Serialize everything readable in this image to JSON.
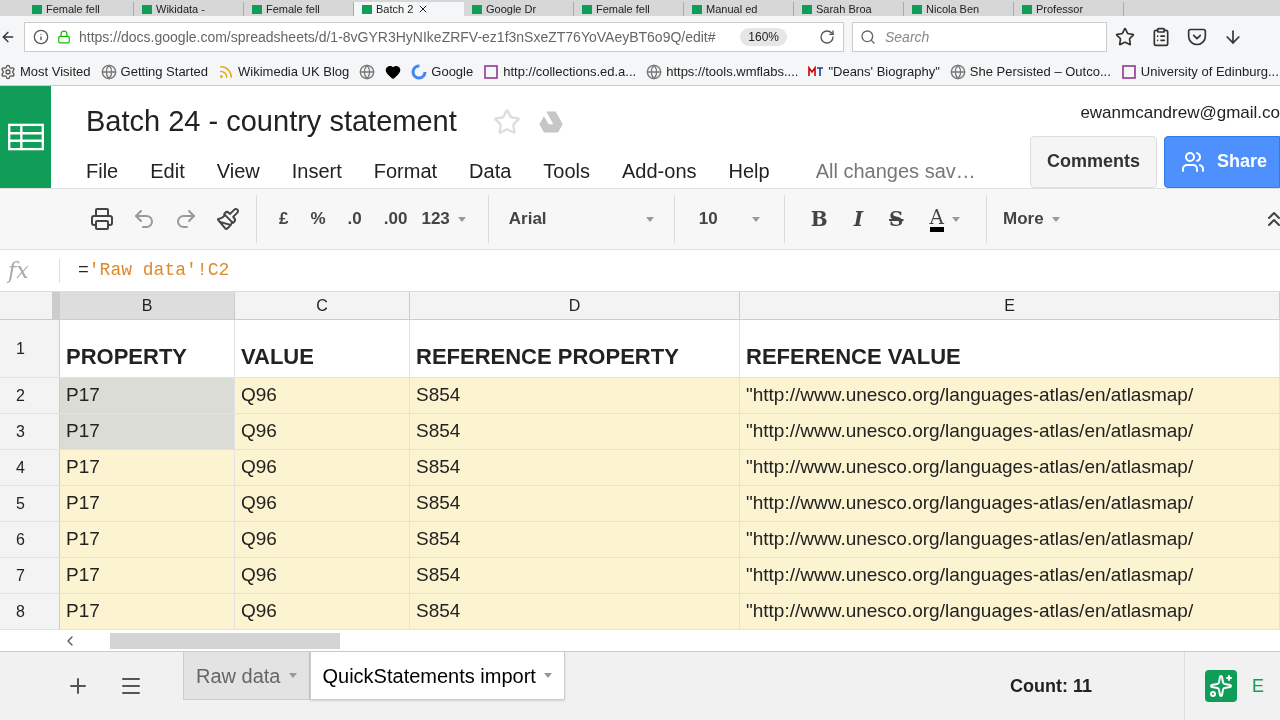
{
  "browser_tabs": [
    {
      "label": "Female fell",
      "selected": false
    },
    {
      "label": "Wikidata -",
      "selected": false
    },
    {
      "label": "Female fell",
      "selected": false
    },
    {
      "label": "Batch 2",
      "selected": true
    },
    {
      "label": "Google Dr",
      "selected": false
    },
    {
      "label": "Female fell",
      "selected": false
    },
    {
      "label": "Manual ed",
      "selected": false
    },
    {
      "label": "Sarah Broa",
      "selected": false
    },
    {
      "label": "Nicola Ben",
      "selected": false
    },
    {
      "label": "Professor",
      "selected": false
    }
  ],
  "address_bar": {
    "url": "https://docs.google.com/spreadsheets/d/1-8vGYR3HyNIkeZRFV-ez1f3nSxeZT76YoVAeyBT6o9Q/edit#",
    "zoom": "160%",
    "search_placeholder": "Search"
  },
  "bookmarks": [
    "Most Visited",
    "Getting Started",
    "Wikimedia UK Blog",
    "Google",
    "http://collections.ed.a...",
    "https://tools.wmflabs....",
    "\"Deans' Biography\"",
    "She Persisted – Outco...",
    "University of Edinburg..."
  ],
  "document": {
    "title": "Batch 24 - country statement",
    "account": "ewanmcandrew@gmail.co",
    "save_status": "All changes sav…",
    "comments_button": "Comments",
    "share_button": "Share"
  },
  "menu": [
    "File",
    "Edit",
    "View",
    "Insert",
    "Format",
    "Data",
    "Tools",
    "Add-ons",
    "Help"
  ],
  "toolbar": {
    "currency": "£",
    "percent": "%",
    "decimal_less": ".0",
    "decimal_more": ".00",
    "number_format": "123",
    "font": "Arial",
    "font_size": "10",
    "bold": "B",
    "italic": "I",
    "strike": "S",
    "text_color": "A",
    "more": "More"
  },
  "formula_bar": {
    "fx": "fx",
    "prefix": "=",
    "formula": "'Raw data'!C2"
  },
  "table": {
    "columns": [
      {
        "label": "B",
        "selected": true
      },
      {
        "label": "C",
        "selected": false
      },
      {
        "label": "D",
        "selected": false
      },
      {
        "label": "E",
        "selected": false
      }
    ],
    "rows": [
      {
        "number": "1",
        "cells": [
          "PROPERTY",
          "VALUE",
          "REFERENCE PROPERTY",
          "REFERENCE VALUE"
        ],
        "kind": "header"
      },
      {
        "number": "2",
        "cells": [
          "P17",
          "Q96",
          "S854",
          "\"http://www.unesco.org/languages-atlas/en/atlasmap/"
        ],
        "selected": true,
        "kind": "data"
      },
      {
        "number": "3",
        "cells": [
          "P17",
          "Q96",
          "S854",
          "\"http://www.unesco.org/languages-atlas/en/atlasmap/"
        ],
        "selected": true,
        "kind": "data"
      },
      {
        "number": "4",
        "cells": [
          "P17",
          "Q96",
          "S854",
          "\"http://www.unesco.org/languages-atlas/en/atlasmap/"
        ],
        "selected": false,
        "kind": "data"
      },
      {
        "number": "5",
        "cells": [
          "P17",
          "Q96",
          "S854",
          "\"http://www.unesco.org/languages-atlas/en/atlasmap/"
        ],
        "selected": false,
        "kind": "data"
      },
      {
        "number": "6",
        "cells": [
          "P17",
          "Q96",
          "S854",
          "\"http://www.unesco.org/languages-atlas/en/atlasmap/"
        ],
        "selected": false,
        "kind": "data"
      },
      {
        "number": "7",
        "cells": [
          "P17",
          "Q96",
          "S854",
          "\"http://www.unesco.org/languages-atlas/en/atlasmap/"
        ],
        "selected": false,
        "kind": "data"
      },
      {
        "number": "8",
        "cells": [
          "P17",
          "Q96",
          "S854",
          "\"http://www.unesco.org/languages-atlas/en/atlasmap/"
        ],
        "selected": false,
        "kind": "data"
      }
    ]
  },
  "sheet_tabs": [
    {
      "label": "Raw data",
      "selected": false
    },
    {
      "label": "QuickStatements import",
      "selected": true
    }
  ],
  "status": {
    "count": "Count: 11",
    "explore": "E"
  }
}
